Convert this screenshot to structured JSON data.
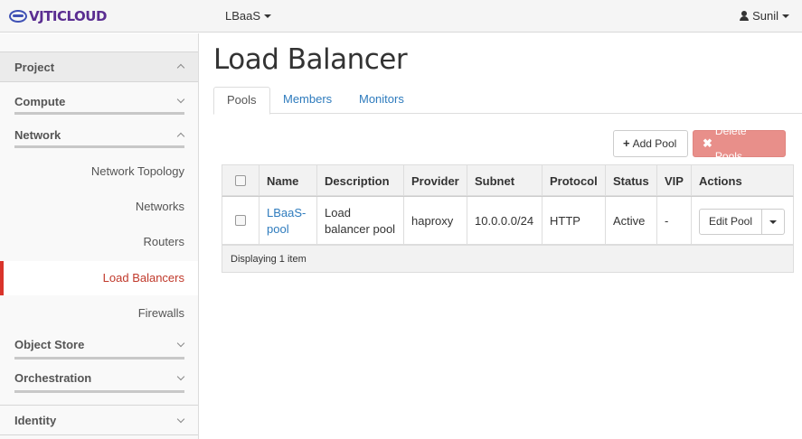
{
  "topbar": {
    "logo_text": "VJTICLOUD",
    "project": "LBaaS",
    "user": "Sunil"
  },
  "sidebar": {
    "project": "Project",
    "compute": "Compute",
    "network": "Network",
    "network_items": [
      "Network Topology",
      "Networks",
      "Routers",
      "Load Balancers",
      "Firewalls"
    ],
    "active_item": "Load Balancers",
    "object_store": "Object Store",
    "orchestration": "Orchestration",
    "identity": "Identity"
  },
  "main": {
    "title": "Load Balancer",
    "tabs": [
      "Pools",
      "Members",
      "Monitors"
    ],
    "active_tab": "Pools",
    "add_button": "Add Pool",
    "delete_button": "Delete Pools"
  },
  "table": {
    "headers": [
      "Name",
      "Description",
      "Provider",
      "Subnet",
      "Protocol",
      "Status",
      "VIP",
      "Actions"
    ],
    "rows": [
      {
        "name_line1": "LBaaS-",
        "name_line2": "pool",
        "description_line1": "Load",
        "description_line2": "balancer pool",
        "provider": "haproxy",
        "subnet": "10.0.0.0/24",
        "protocol": "HTTP",
        "status": "Active",
        "vip": "-",
        "action": "Edit Pool"
      }
    ],
    "footer": "Displaying 1 item"
  },
  "colors": {
    "link": "#2e7bbd",
    "active_sidebar": "#c0392b",
    "danger_button": "#e88f8a",
    "logo": "#5a2d91"
  }
}
